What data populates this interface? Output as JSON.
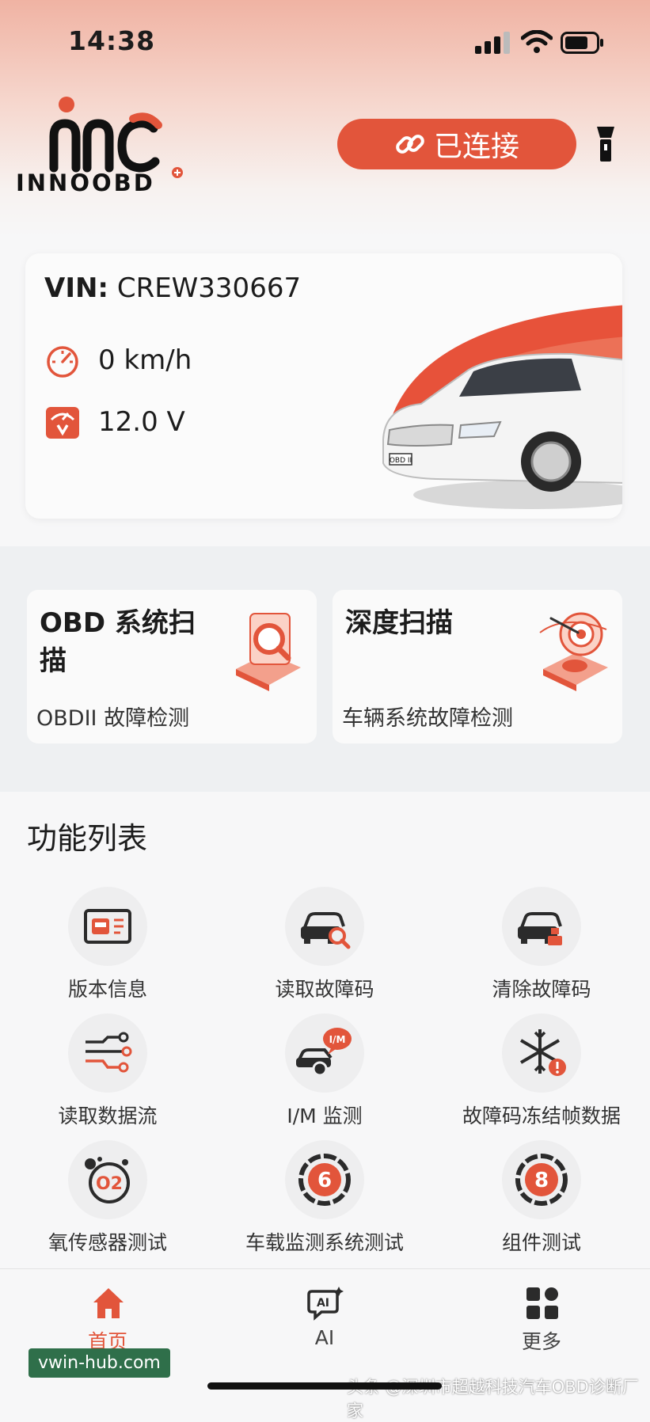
{
  "status_bar": {
    "time": "14:38"
  },
  "brand": {
    "name": "INNOOBD"
  },
  "header": {
    "connect_label": "已连接"
  },
  "vehicle": {
    "vin_label": "VIN:",
    "vin_value": "CREW330667",
    "speed": "0 km/h",
    "voltage": "12.0 V",
    "car_plate": "OBD II"
  },
  "scan_cards": [
    {
      "title": "OBD 系统扫描",
      "subtitle": "OBDII 故障检测"
    },
    {
      "title": "深度扫描",
      "subtitle": "车辆系统故障检测"
    }
  ],
  "functions": {
    "title": "功能列表",
    "items": [
      {
        "label": "版本信息",
        "icon": "id-card-icon"
      },
      {
        "label": "读取故障码",
        "icon": "car-search-icon"
      },
      {
        "label": "清除故障码",
        "icon": "car-clear-icon"
      },
      {
        "label": "读取数据流",
        "icon": "data-stream-icon"
      },
      {
        "label": "I/M 监测",
        "icon": "im-monitor-icon",
        "badge": "I/M"
      },
      {
        "label": "故障码冻结帧数据",
        "icon": "freeze-frame-icon"
      },
      {
        "label": "氧传感器测试",
        "icon": "oxygen-sensor-icon",
        "badge": "O2"
      },
      {
        "label": "车载监测系统测试",
        "icon": "mode6-icon",
        "badge": "6"
      },
      {
        "label": "组件测试",
        "icon": "mode8-icon",
        "badge": "8"
      }
    ]
  },
  "tabs": [
    {
      "label": "首页",
      "icon": "home-icon",
      "active": true
    },
    {
      "label": "AI",
      "icon": "ai-icon",
      "badge": "AI"
    },
    {
      "label": "更多",
      "icon": "grid-icon"
    }
  ],
  "watermarks": {
    "left": "vwin-hub.com",
    "right": "头条 @深圳市超越科技汽车OBD诊断厂家"
  },
  "colors": {
    "accent": "#e2553b",
    "background": "#f7f7f8"
  }
}
